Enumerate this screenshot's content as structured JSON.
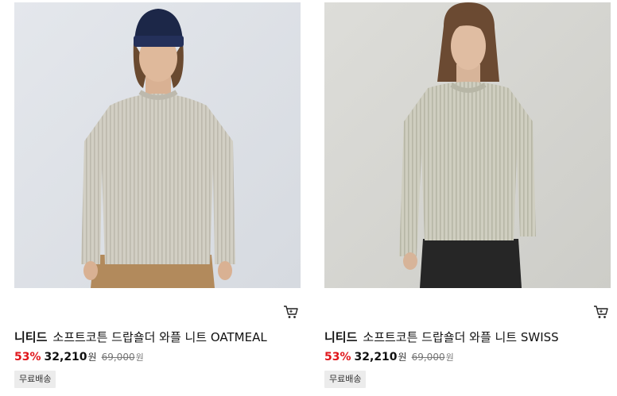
{
  "products": [
    {
      "brand": "니티드",
      "name": "소프트코튼 드랍숄더 와플 니트 OATMEAL",
      "discount": "53%",
      "sale_price": "32,210",
      "currency": "원",
      "original_price": "69,000",
      "badge": "무료배송",
      "icon": "cart-icon"
    },
    {
      "brand": "니티드",
      "name": "소프트코튼 드랍숄더 와플 니트 SWISS",
      "discount": "53%",
      "sale_price": "32,210",
      "currency": "원",
      "original_price": "69,000",
      "badge": "무료배송",
      "icon": "cart-icon"
    }
  ],
  "colors": {
    "discount": "#e0161b",
    "badge_bg": "#ececec"
  }
}
